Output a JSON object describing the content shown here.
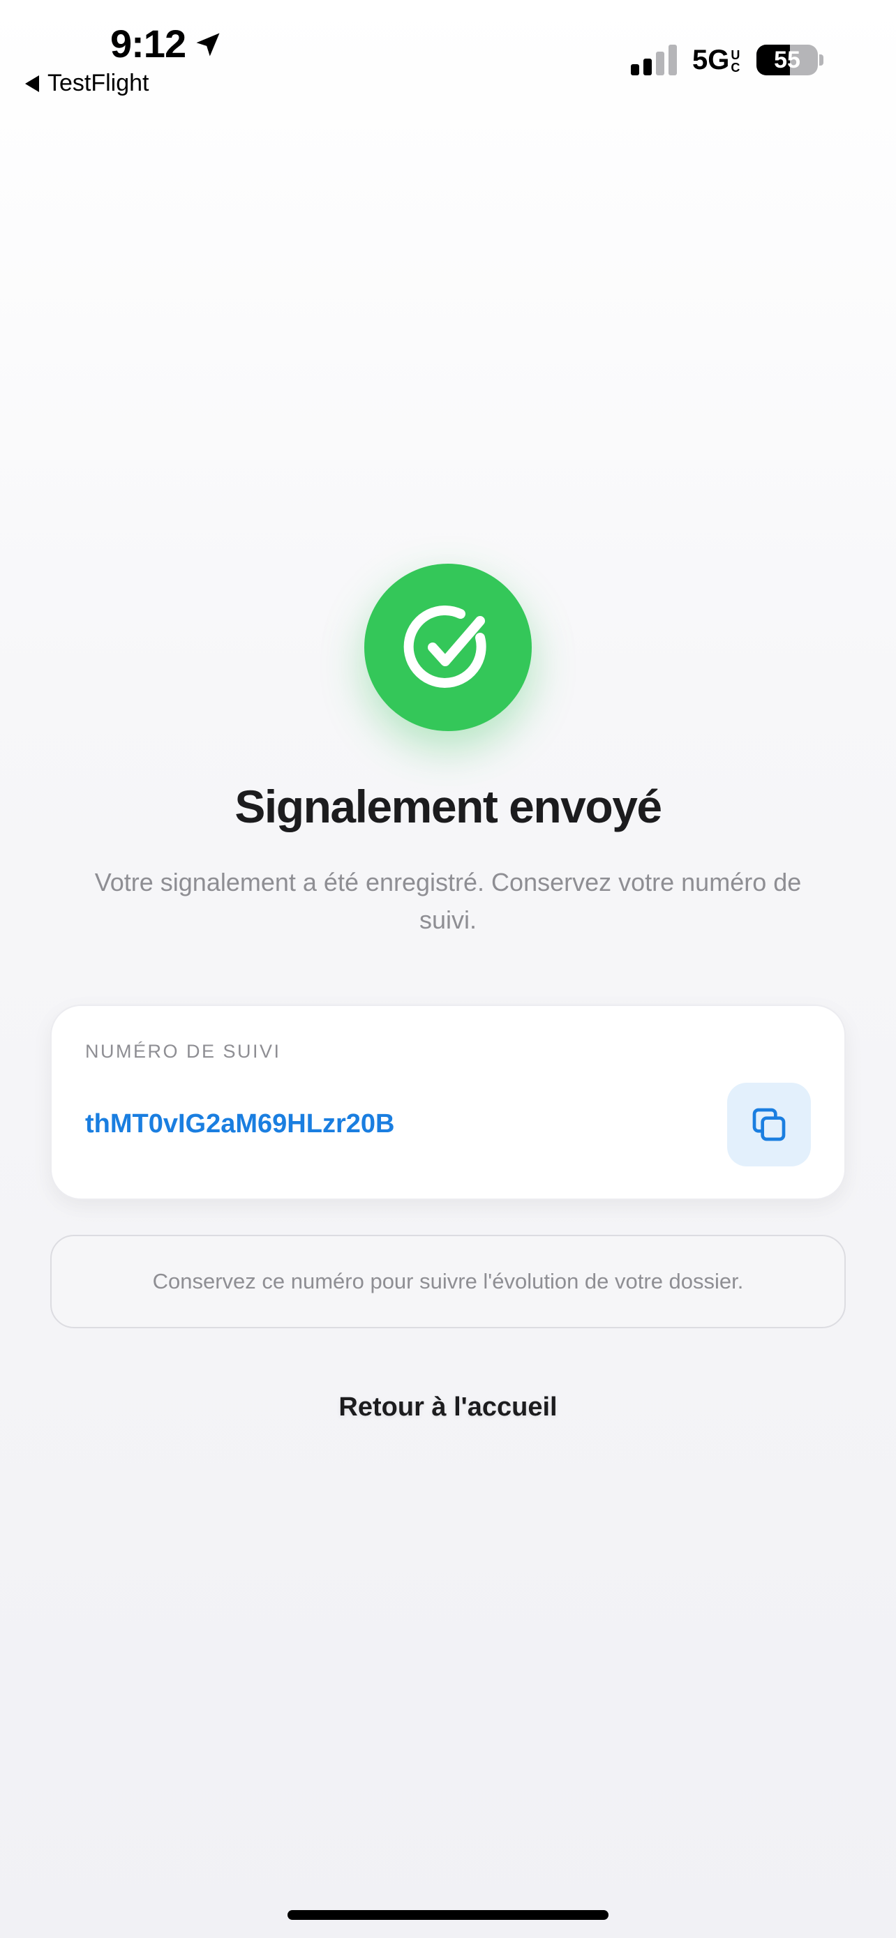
{
  "status_bar": {
    "time": "9:12",
    "back_app": "TestFlight",
    "network": "5G",
    "network_sub_1": "U",
    "network_sub_2": "C",
    "battery_percent": 55,
    "battery_label": "55"
  },
  "main": {
    "title": "Signalement envoyé",
    "subtitle": "Votre signalement a été enregistré. Conservez votre numéro de suivi."
  },
  "tracking_card": {
    "label": "NUMÉRO DE SUIVI",
    "value": "thMT0vIG2aM69HLzr20B"
  },
  "info_box": {
    "text": "Conservez ce numéro pour suivre l'évolution de votre dossier."
  },
  "actions": {
    "home_link": "Retour à l'accueil"
  },
  "colors": {
    "success_green": "#34c759",
    "accent_blue": "#1a7ee0",
    "copy_button_bg": "#e3f0fc"
  },
  "icons": {
    "location": "location-arrow-icon",
    "back": "back-triangle-icon",
    "success": "check-circle-icon",
    "copy": "copy-icon"
  }
}
